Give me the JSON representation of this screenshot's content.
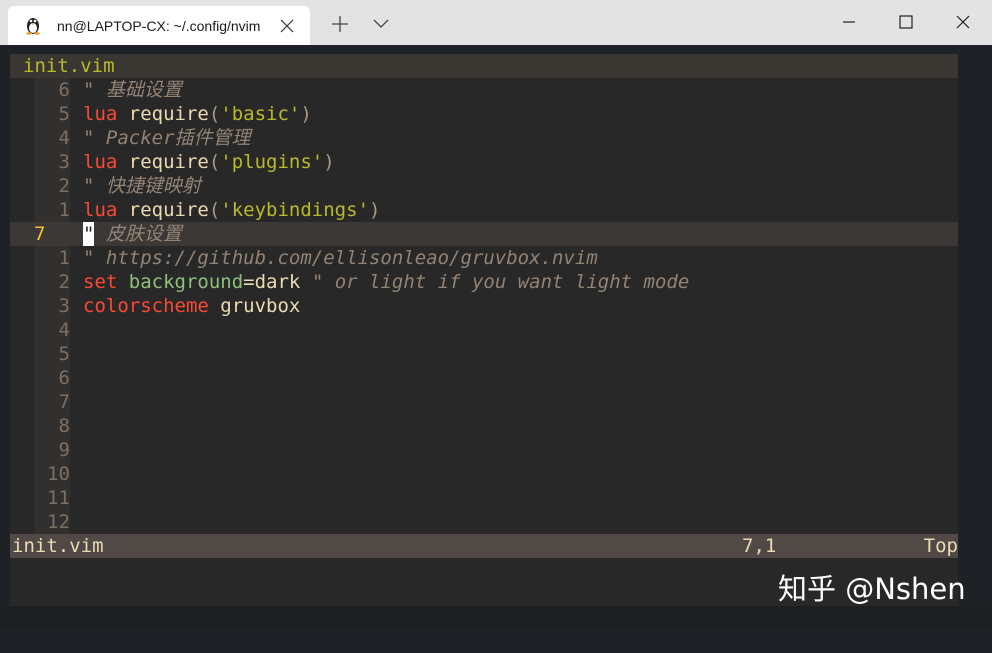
{
  "window": {
    "tab_title": "nn@LAPTOP-CX: ~/.config/nvim",
    "tab_icon": "linux-penguin-icon"
  },
  "editor": {
    "winbar_filename": "init.vim",
    "lines": [
      {
        "num": "6",
        "segments": [
          {
            "t": "\" 基础设置",
            "c": "cmt"
          }
        ]
      },
      {
        "num": "5",
        "segments": [
          {
            "t": "lua",
            "c": "kw"
          },
          {
            "t": " require",
            "c": "fn"
          },
          {
            "t": "(",
            "c": "par"
          },
          {
            "t": "'basic'",
            "c": "str"
          },
          {
            "t": ")",
            "c": "par"
          }
        ]
      },
      {
        "num": "4",
        "segments": [
          {
            "t": "\" Packer插件管理",
            "c": "cmt"
          }
        ]
      },
      {
        "num": "3",
        "segments": [
          {
            "t": "lua",
            "c": "kw"
          },
          {
            "t": " require",
            "c": "fn"
          },
          {
            "t": "(",
            "c": "par"
          },
          {
            "t": "'plugins'",
            "c": "str"
          },
          {
            "t": ")",
            "c": "par"
          }
        ]
      },
      {
        "num": "2",
        "segments": [
          {
            "t": "\" 快捷键映射",
            "c": "cmt"
          }
        ]
      },
      {
        "num": "1",
        "segments": [
          {
            "t": "lua",
            "c": "kw"
          },
          {
            "t": " require",
            "c": "fn"
          },
          {
            "t": "(",
            "c": "par"
          },
          {
            "t": "'keybindings'",
            "c": "str"
          },
          {
            "t": ")",
            "c": "par"
          }
        ]
      },
      {
        "num": "7",
        "current": true,
        "segments": [
          {
            "t": "\"",
            "c": "cursor"
          },
          {
            "t": " 皮肤设置",
            "c": "cmt"
          }
        ]
      },
      {
        "num": "1",
        "segments": [
          {
            "t": "\" https://github.com/ellisonleao/gruvbox.nvim",
            "c": "cmt"
          }
        ]
      },
      {
        "num": "2",
        "segments": [
          {
            "t": "set",
            "c": "kw"
          },
          {
            "t": " background",
            "c": "grn"
          },
          {
            "t": "=dark",
            "c": "txt"
          },
          {
            "t": " \" or light if you want light mode",
            "c": "cmt"
          }
        ]
      },
      {
        "num": "3",
        "segments": [
          {
            "t": "colorscheme",
            "c": "kw"
          },
          {
            "t": " gruvbox",
            "c": "fn"
          }
        ]
      },
      {
        "num": "4",
        "segments": []
      },
      {
        "num": "5",
        "segments": []
      },
      {
        "num": "6",
        "segments": []
      },
      {
        "num": "7",
        "segments": []
      },
      {
        "num": "8",
        "segments": []
      },
      {
        "num": "9",
        "segments": []
      },
      {
        "num": "10",
        "segments": []
      },
      {
        "num": "11",
        "segments": []
      },
      {
        "num": "12",
        "segments": []
      }
    ]
  },
  "statusline": {
    "filename": "init.vim",
    "position": "7,1",
    "scroll": "Top"
  },
  "watermark": "知乎 @Nshen"
}
